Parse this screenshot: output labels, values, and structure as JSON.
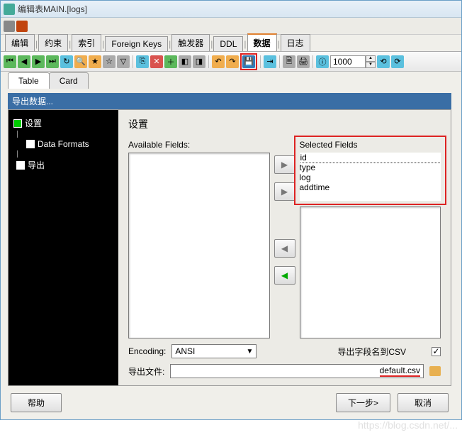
{
  "window": {
    "title": "编辑表MAIN.[logs]"
  },
  "tabs": {
    "items": [
      "编辑",
      "约束",
      "索引",
      "Foreign Keys",
      "触发器",
      "DDL",
      "数据",
      "日志"
    ],
    "active_index": 6
  },
  "toolbar": {
    "row_count": "1000"
  },
  "sub_tabs": {
    "table": "Table",
    "card": "Card"
  },
  "export": {
    "header": "导出数据...",
    "tree": {
      "settings": "设置",
      "data_formats": "Data Formats",
      "export": "导出"
    },
    "panel": {
      "title": "设置",
      "available_label": "Available Fields:",
      "selected_label": "Selected Fields",
      "selected_items": [
        "id",
        "type",
        "log",
        "addtime"
      ],
      "encoding_label": "Encoding:",
      "encoding_value": "ANSI",
      "csv_header_label": "导出字段名到CSV",
      "csv_header_checked": true,
      "file_label": "导出文件:",
      "file_value_suffix": "default.csv"
    }
  },
  "buttons": {
    "help": "帮助",
    "next": "下一步>",
    "cancel": "取消"
  },
  "glyphs": {
    "right": "▶",
    "right_fill": "▶",
    "left": "◀",
    "left_fill": "◀",
    "dropdown": "▼",
    "up": "▲",
    "down": "▼",
    "check": "✓"
  },
  "watermark": "https://blog.csdn.net/... "
}
